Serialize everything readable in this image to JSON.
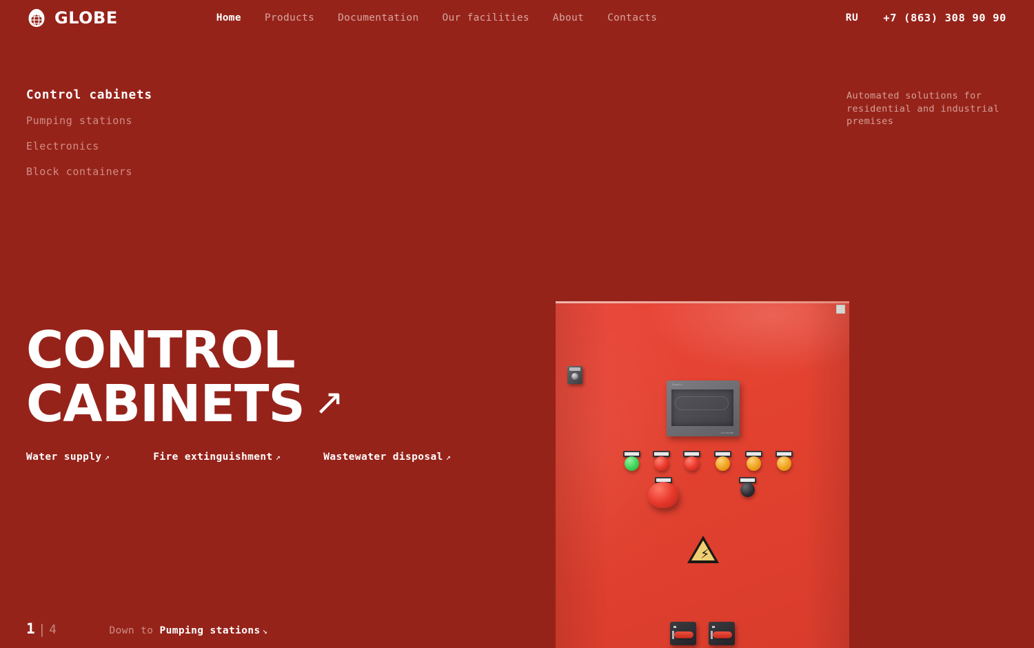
{
  "header": {
    "logo_icon": "globe-dome-icon",
    "brand": "GLOBE",
    "nav": [
      {
        "label": "Home",
        "active": true
      },
      {
        "label": "Products",
        "active": false
      },
      {
        "label": "Documentation",
        "active": false
      },
      {
        "label": "Our facilities",
        "active": false
      },
      {
        "label": "About",
        "active": false
      },
      {
        "label": "Contacts",
        "active": false
      }
    ],
    "language": "RU",
    "phone": "+7 (863) 308 90 90"
  },
  "categories": [
    {
      "label": "Control cabinets",
      "active": true
    },
    {
      "label": "Pumping stations",
      "active": false
    },
    {
      "label": "Electronics",
      "active": false
    },
    {
      "label": "Block containers",
      "active": false
    }
  ],
  "tagline": "Automated solutions for residential and industrial premises",
  "hero": {
    "title": "CONTROL\nCABINETS",
    "title_arrow": "↗",
    "sublinks": [
      {
        "label": "Water supply",
        "arrow": "↗"
      },
      {
        "label": "Fire extinguishment",
        "arrow": "↗"
      },
      {
        "label": "Wastewater disposal",
        "arrow": "↗"
      }
    ]
  },
  "footer": {
    "current_slide": "1",
    "separator": "|",
    "total_slides": "4",
    "down_label": "Down to",
    "down_target": "Pumping stations",
    "down_arrow": "↘"
  },
  "photo": {
    "alt": "Red electrical control cabinet front panel",
    "hmi_brand_top": "Magelis",
    "hmi_brand_bottom": "Schneider",
    "warning_symbol": "⚡",
    "buttons": [
      {
        "name": "indicator-lamp-green",
        "color": "#3ed357"
      },
      {
        "name": "indicator-lamp-red-1",
        "color": "#e8392c"
      },
      {
        "name": "indicator-lamp-red-2",
        "color": "#e8392c"
      },
      {
        "name": "indicator-lamp-amber-1",
        "color": "#f0a31e"
      },
      {
        "name": "indicator-lamp-amber-2",
        "color": "#f0a31e"
      },
      {
        "name": "indicator-lamp-amber-3",
        "color": "#f0a31e"
      }
    ],
    "emergency_stop": "emergency-stop-button",
    "selector": "selector-switch-black",
    "disconnects": [
      "main-disconnect-switch-1",
      "main-disconnect-switch-2"
    ]
  },
  "colors": {
    "background": "#96231a",
    "cabinet": "#e8473a",
    "text_primary": "#ffffff",
    "text_muted": "#cf8e85"
  }
}
